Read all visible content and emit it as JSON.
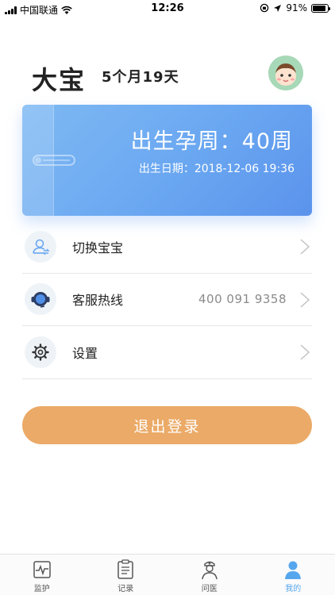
{
  "status_bar": {
    "carrier": "中国联通",
    "time": "12:26",
    "battery_text": "91%",
    "battery_level": 0.91
  },
  "profile": {
    "name": "大宝",
    "age": "5个月19天",
    "avatar_icon": "baby-face-icon"
  },
  "card": {
    "gestation": "出生孕周：40周",
    "birth_date": "出生日期：2018-12-06 19:36",
    "decoration_icon": "safety-pin-icon"
  },
  "menu": {
    "items": [
      {
        "label": "切换宝宝",
        "icon": "switch-user-icon"
      },
      {
        "label": "客服热线",
        "icon": "headset-icon",
        "value": "400 091 9358"
      },
      {
        "label": "设置",
        "icon": "gear-icon"
      }
    ]
  },
  "logout_label": "退出登录",
  "tabs": [
    {
      "label": "监护",
      "icon": "monitor-icon"
    },
    {
      "label": "记录",
      "icon": "notepad-icon"
    },
    {
      "label": "问医",
      "icon": "doctor-icon"
    },
    {
      "label": "我的",
      "icon": "person-icon",
      "active": true
    }
  ],
  "colors": {
    "card_blue": "#6aa7f1",
    "logout_orange": "#ebaa67",
    "tab_active": "#56a6ee"
  }
}
